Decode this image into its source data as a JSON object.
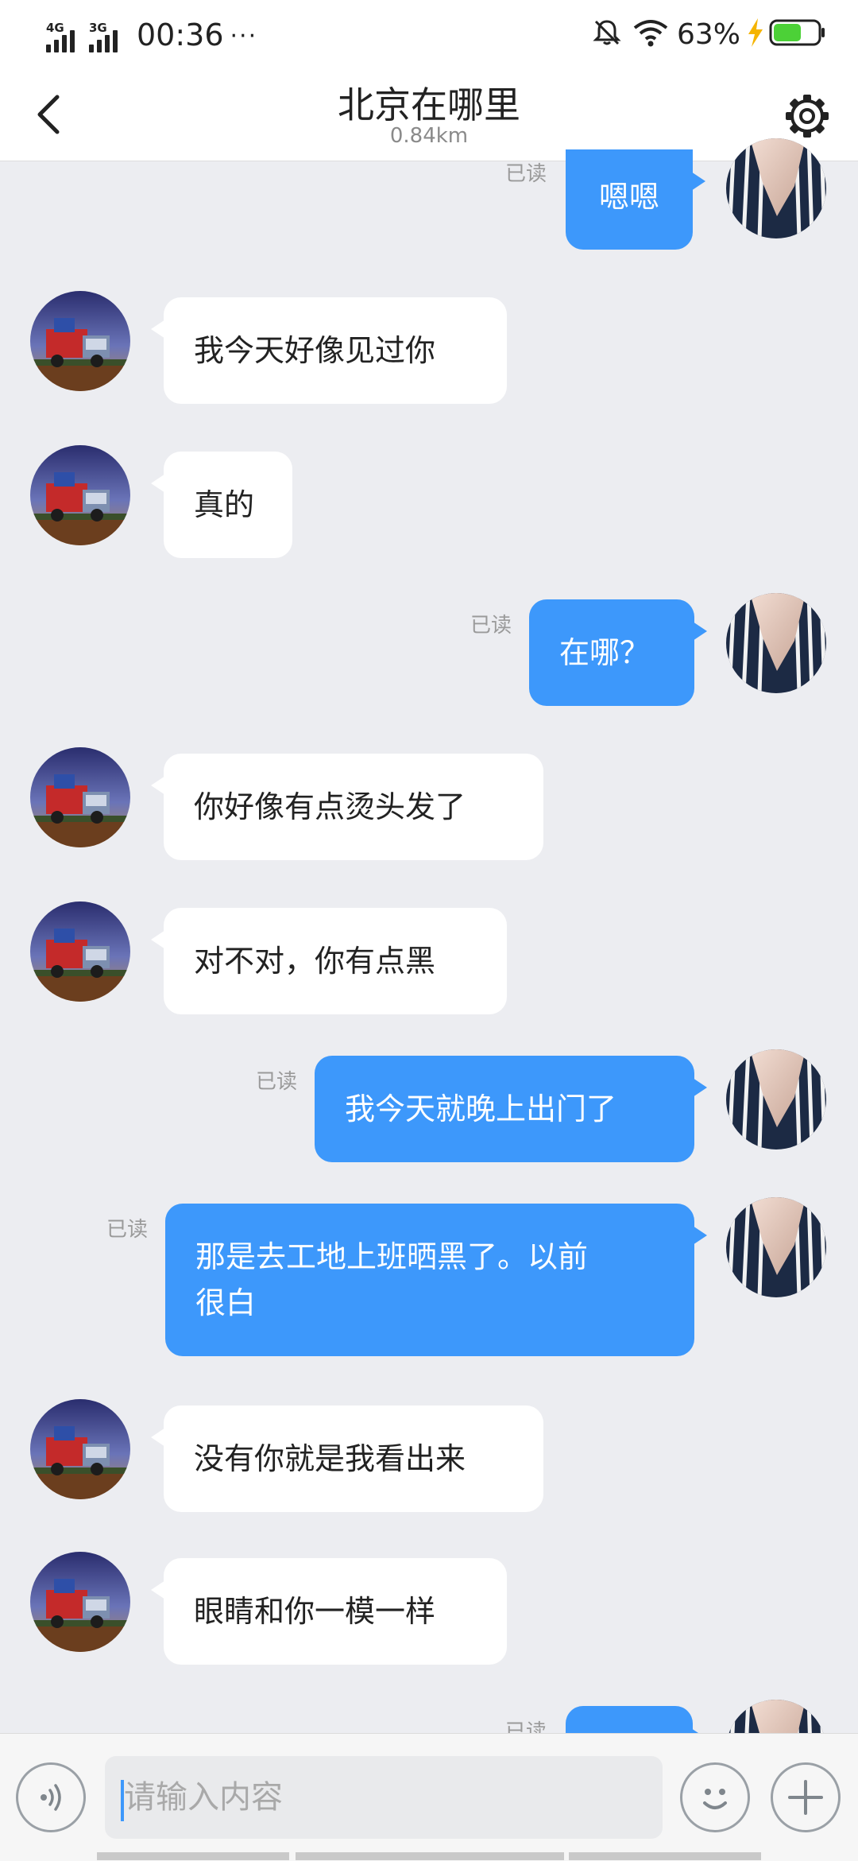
{
  "status_bar": {
    "network_1": "4G",
    "network_2": "3G",
    "time": "00:36",
    "more": "···",
    "battery_percent": "63%",
    "battery_level": 0.63,
    "icons": [
      "mute-bell-icon",
      "wifi-icon",
      "charging-icon",
      "battery-icon"
    ]
  },
  "header": {
    "title": "北京在哪里",
    "subtitle": "0.84km",
    "back_icon": "chevron-left-icon",
    "settings_icon": "gear-icon"
  },
  "messages": [
    {
      "side": "out",
      "text": "嗯嗯",
      "read": "已读"
    },
    {
      "side": "in",
      "text": "我今天好像见过你"
    },
    {
      "side": "in",
      "text": "真的"
    },
    {
      "side": "out",
      "text": "在哪？",
      "read": "已读"
    },
    {
      "side": "in",
      "text": "你好像有点烫头发了"
    },
    {
      "side": "in",
      "text": "对不对，你有点黑"
    },
    {
      "side": "out",
      "text": "我今天就晚上出门了",
      "read": "已读"
    },
    {
      "side": "out",
      "line1": "那是去工地上班晒黑了。以前",
      "line2": "很白",
      "read": "已读"
    },
    {
      "side": "in",
      "text": "没有你就是我看出来"
    },
    {
      "side": "in",
      "text": "眼睛和你一模一样"
    },
    {
      "side": "out",
      "text": "",
      "read": "已读"
    }
  ],
  "input_bar": {
    "placeholder": "请输入内容",
    "voice_icon": "voice-icon",
    "emoji_icon": "emoji-icon",
    "add_icon": "plus-icon"
  },
  "colors": {
    "outgoing_bubble": "#3d98fb",
    "incoming_bubble": "#ffffff",
    "chat_background": "#ecedf1"
  }
}
